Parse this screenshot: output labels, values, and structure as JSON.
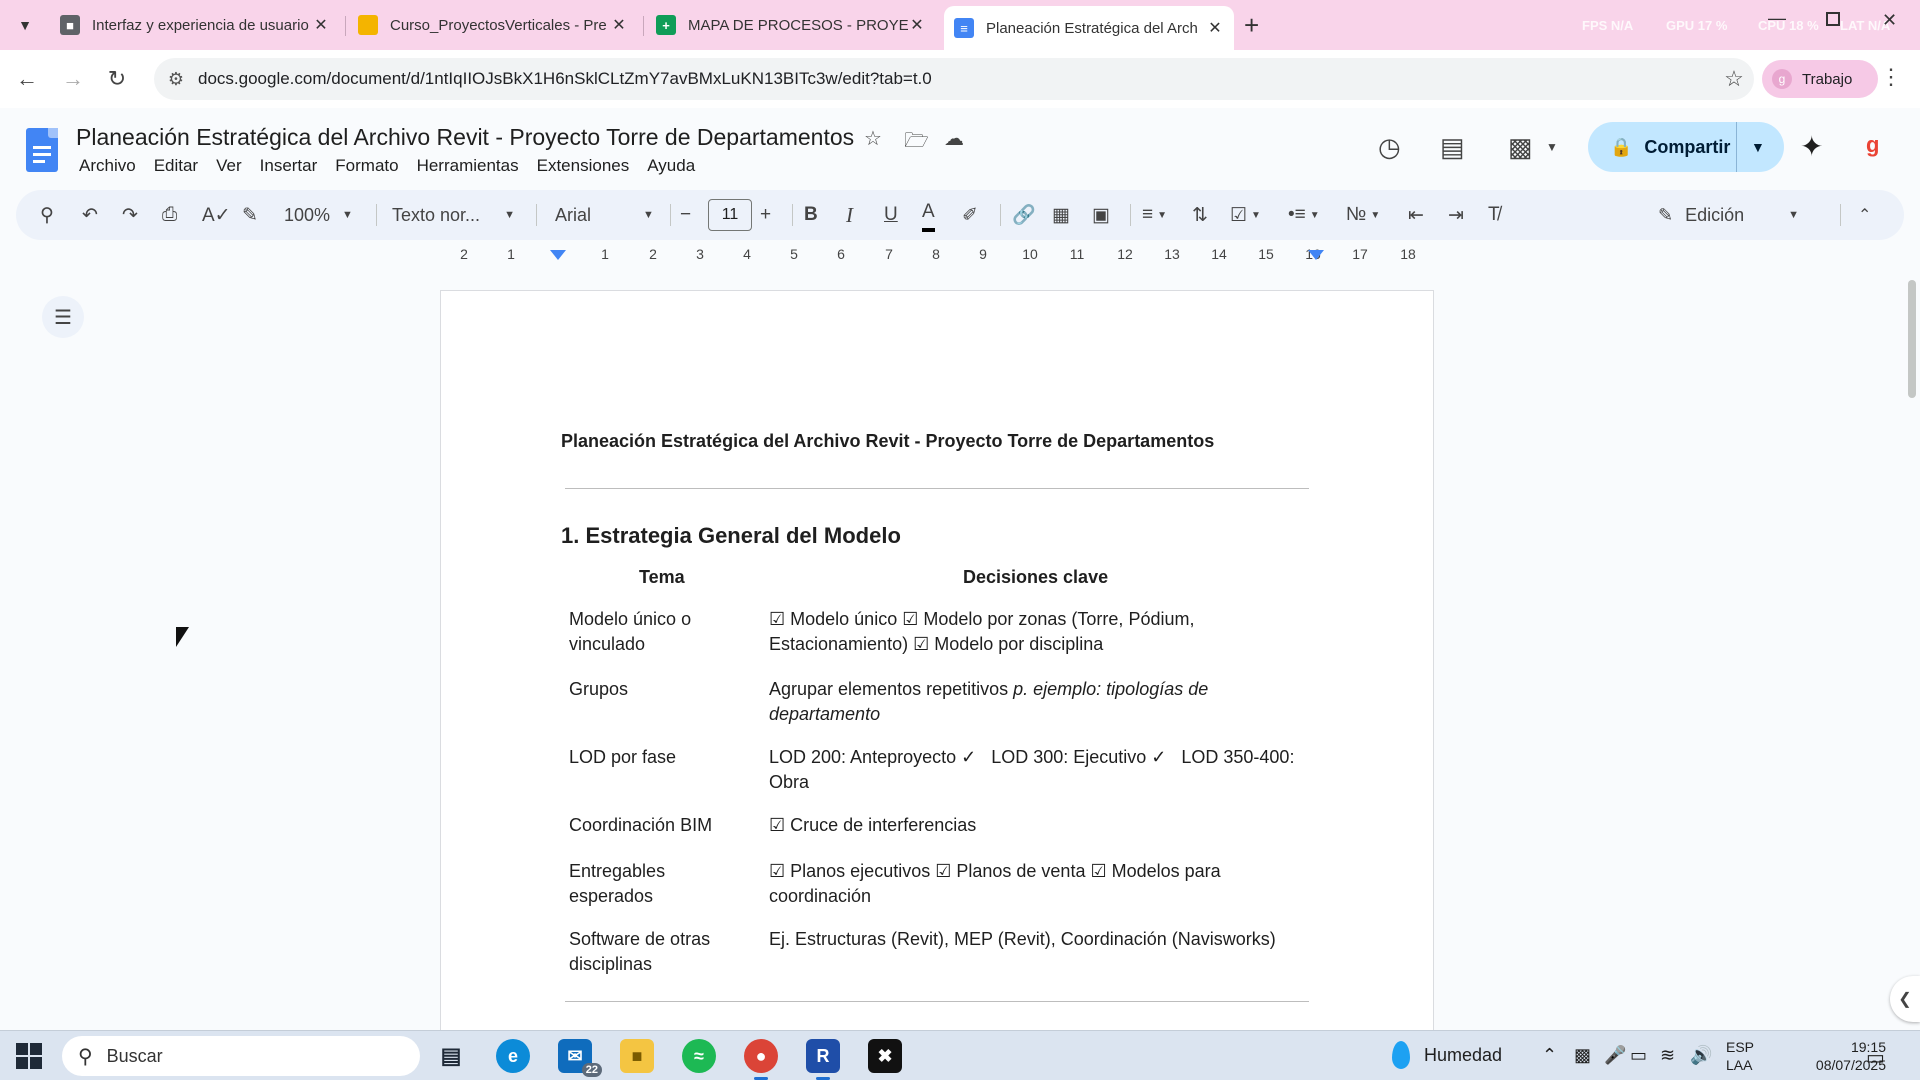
{
  "browser": {
    "tabs": [
      {
        "title": "Interfaz y experiencia de usuario",
        "icon": "cube-icon",
        "color": "#5f6368"
      },
      {
        "title": "Curso_ProyectosVerticales - Pre",
        "icon": "slides-icon",
        "color": "#f4b400"
      },
      {
        "title": "MAPA DE PROCESOS - PROYECTO",
        "icon": "sheets-icon",
        "color": "#0f9d58"
      },
      {
        "title": "Planeación Estratégica del Arch",
        "icon": "docs-icon",
        "color": "#4285f4"
      }
    ],
    "new_tab": "+",
    "url": "docs.google.com/document/d/1ntIqIIOJsBkX1H6nSklCLtZmY7avBMxLuKN13BITc3w/edit?tab=t.0",
    "profile": "Trabajo",
    "profile_initial": "g",
    "overlay": {
      "fps": "FPS N/A",
      "gpu": "GPU 17 %",
      "cpu": "CPU 18 %",
      "lat": "LAT N/A"
    }
  },
  "doc": {
    "title": "Planeación Estratégica del Archivo Revit - Proyecto Torre de Departamentos",
    "menu": [
      "Archivo",
      "Editar",
      "Ver",
      "Insertar",
      "Formato",
      "Herramientas",
      "Extensiones",
      "Ayuda"
    ],
    "share_label": "Compartir",
    "account_letter": "g"
  },
  "toolbar": {
    "zoom": "100%",
    "style": "Texto nor...",
    "font": "Arial",
    "font_size": "11",
    "mode": "Edición"
  },
  "ruler": {
    "labels": [
      "2",
      "1",
      "1",
      "2",
      "3",
      "4",
      "5",
      "6",
      "7",
      "8",
      "9",
      "10",
      "11",
      "12",
      "13",
      "14",
      "15",
      "16",
      "17",
      "18"
    ]
  },
  "content": {
    "heading": "Planeación Estratégica del Archivo Revit - Proyecto Torre de Departamentos",
    "section1": "1. Estrategia General del Modelo",
    "col_tema": "Tema",
    "col_decisiones": "Decisiones clave",
    "rows": [
      {
        "tema": "Modelo único o vinculado",
        "decision": "☑ Modelo único ☑ Modelo por zonas (Torre, Pódium, Estacionamiento) ☑ Modelo por disciplina",
        "italic": ""
      },
      {
        "tema": "Grupos",
        "decision": "Agrupar elementos repetitivos ",
        "italic": "p. ejemplo: tipologías de departamento"
      },
      {
        "tema": "LOD por fase",
        "decision": "LOD 200: Anteproyecto ✓   LOD 300: Ejecutivo ✓   LOD 350-400: Obra",
        "italic": ""
      },
      {
        "tema": "Coordinación BIM",
        "decision": "☑ Cruce de interferencias",
        "italic": ""
      },
      {
        "tema": "Entregables esperados",
        "decision": "☑ Planos ejecutivos ☑ Planos de venta ☑ Modelos para coordinación",
        "italic": ""
      },
      {
        "tema": "Software de otras disciplinas",
        "decision": "Ej. Estructuras (Revit), MEP (Revit), Coordinación (Navisworks)",
        "italic": ""
      }
    ]
  },
  "taskbar": {
    "search_placeholder": "Buscar",
    "mail_badge": "22",
    "weather": "Humedad",
    "lang_top": "ESP",
    "lang_bottom": "LAA",
    "time": "19:15",
    "date": "08/07/2025"
  }
}
